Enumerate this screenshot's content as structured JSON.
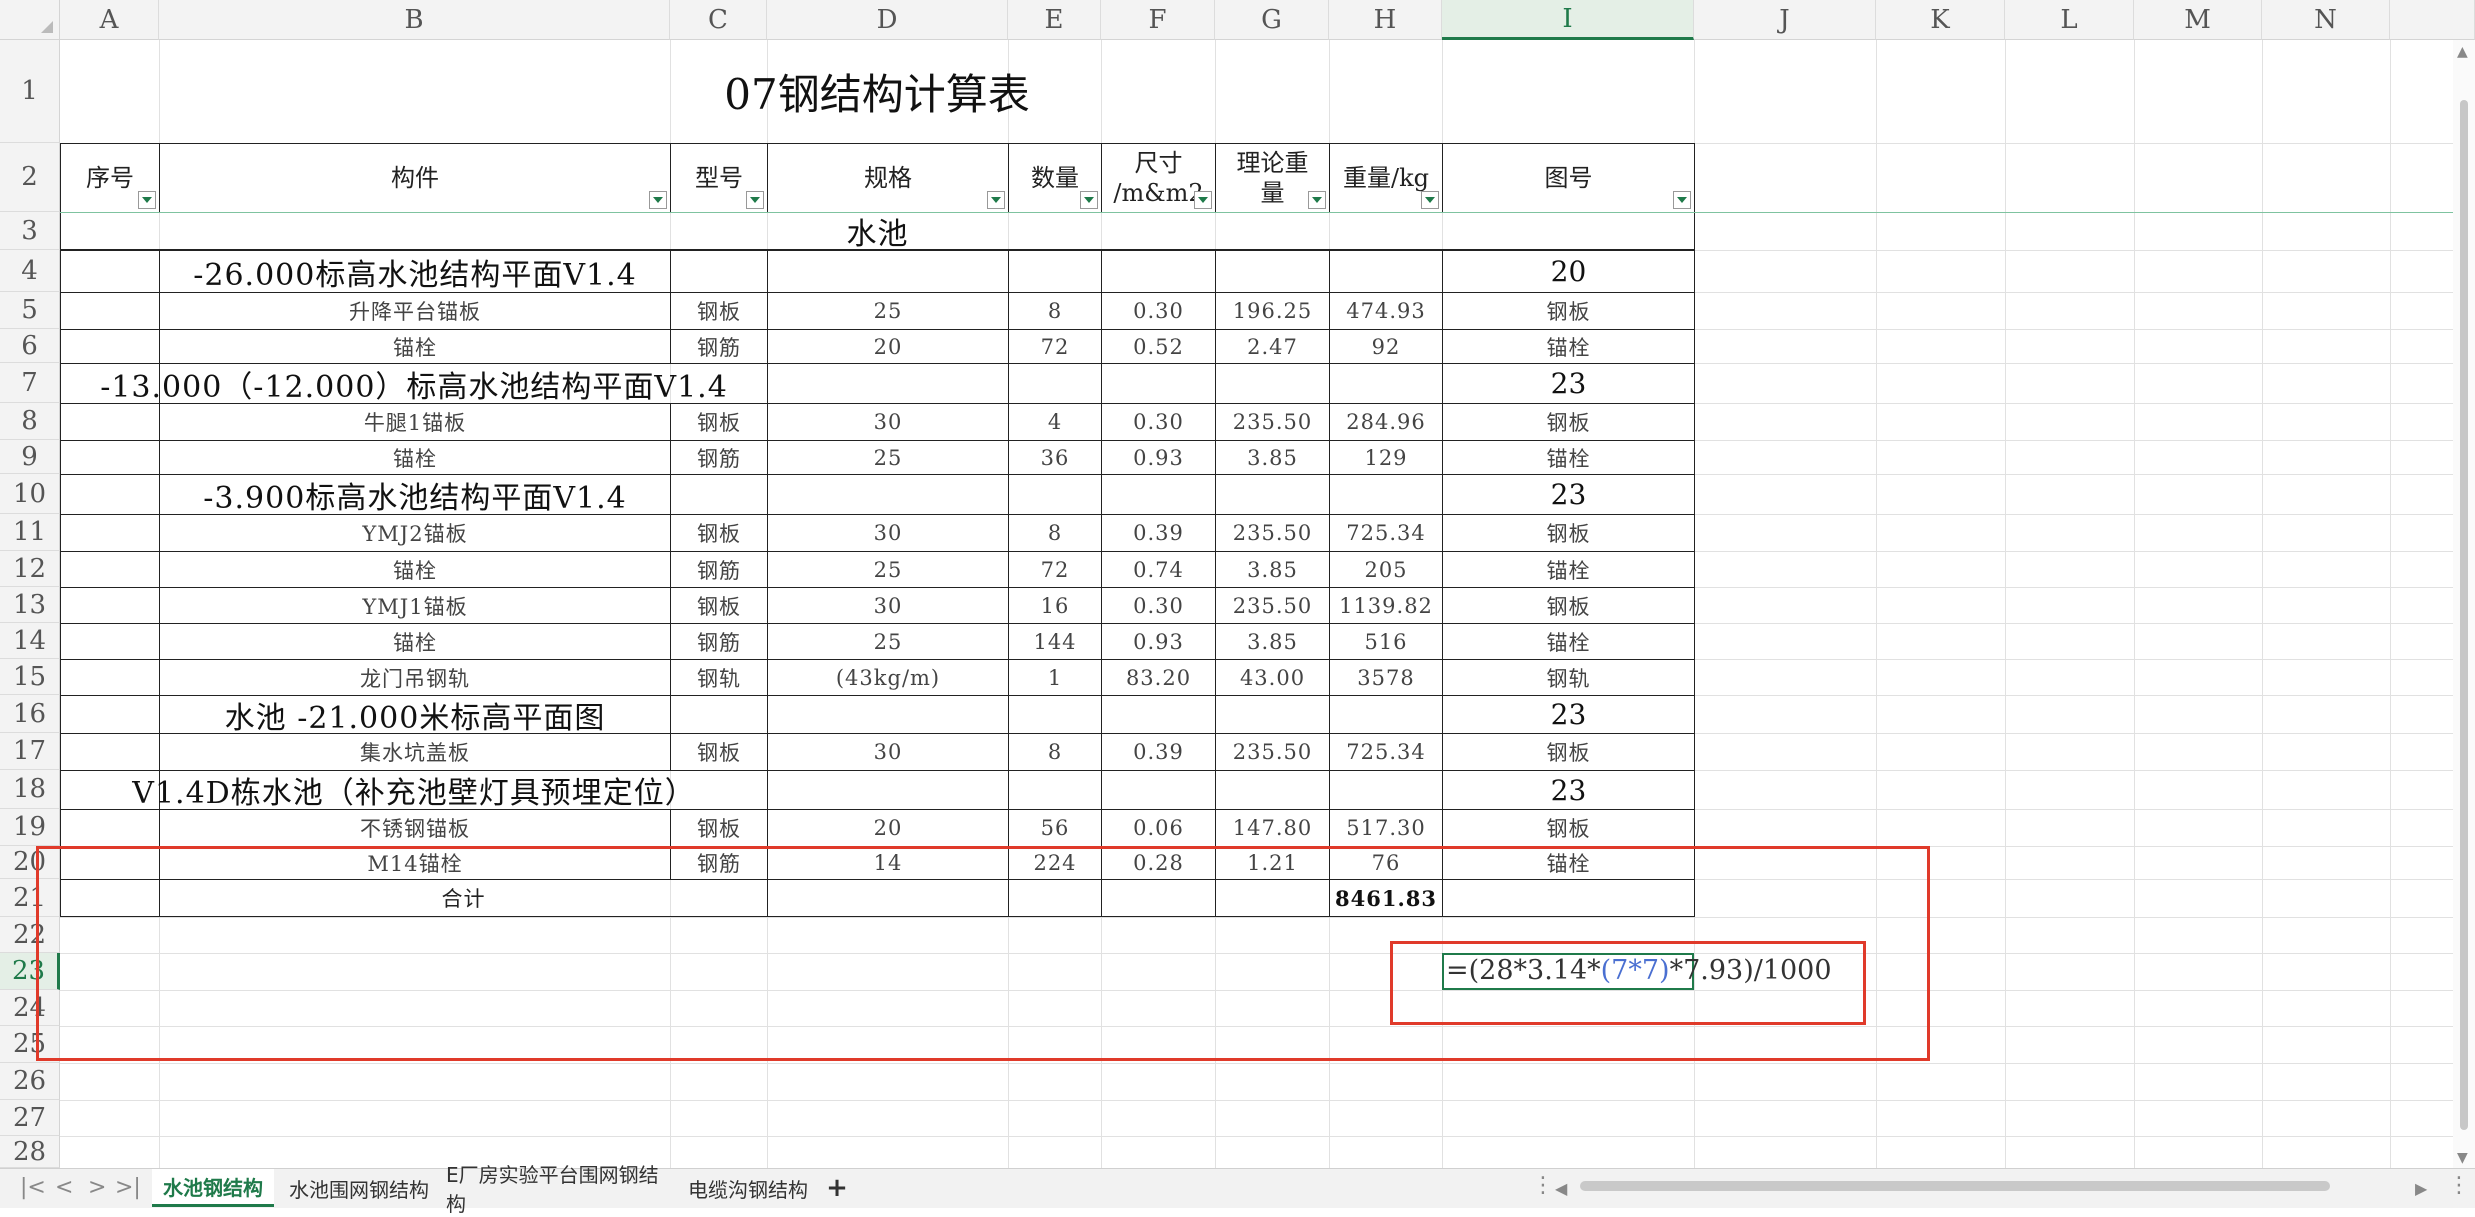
{
  "columns": [
    "A",
    "B",
    "C",
    "D",
    "E",
    "F",
    "G",
    "H",
    "I",
    "J",
    "K",
    "L",
    "M",
    "N"
  ],
  "rows": [
    "1",
    "2",
    "3",
    "4",
    "5",
    "6",
    "7",
    "8",
    "9",
    "10",
    "11",
    "12",
    "13",
    "14",
    "15",
    "16",
    "17",
    "18",
    "19",
    "20",
    "21",
    "22",
    "23",
    "24",
    "25",
    "26",
    "27",
    "28"
  ],
  "title": "07钢结构计算表",
  "headers": {
    "a": "序号",
    "b": "构件",
    "c": "型号",
    "d": "规格",
    "e": "数量",
    "f1": "尺寸",
    "f2": "/m&m2",
    "g1": "理论重",
    "g2": "量",
    "h": "重量/kg",
    "i": "图号"
  },
  "section_title": "水池",
  "sections": [
    {
      "text": "-26.000标高水池结构平面V1.4",
      "num": "20"
    },
    {
      "text": "-13.000（-12.000）标高水池结构平面V1.4",
      "num": "23"
    },
    {
      "text": "-3.900标高水池结构平面V1.4",
      "num": "23"
    },
    {
      "text": "水池  -21.000米标高平面图",
      "num": "23"
    },
    {
      "text": "V1.4D栋水池（补充池壁灯具预埋定位）",
      "num": "23"
    }
  ],
  "data_rows": [
    {
      "b": "升降平台锚板",
      "c": "钢板",
      "d": "25",
      "e": "8",
      "f": "0.30",
      "g": "196.25",
      "h": "474.93",
      "i": "钢板"
    },
    {
      "b": "锚栓",
      "c": "钢筋",
      "d": "20",
      "e": "72",
      "f": "0.52",
      "g": "2.47",
      "h": "92",
      "i": "锚栓"
    },
    {
      "b": "牛腿1锚板",
      "c": "钢板",
      "d": "30",
      "e": "4",
      "f": "0.30",
      "g": "235.50",
      "h": "284.96",
      "i": "钢板"
    },
    {
      "b": "锚栓",
      "c": "钢筋",
      "d": "25",
      "e": "36",
      "f": "0.93",
      "g": "3.85",
      "h": "129",
      "i": "锚栓"
    },
    {
      "b": "YMJ2锚板",
      "c": "钢板",
      "d": "30",
      "e": "8",
      "f": "0.39",
      "g": "235.50",
      "h": "725.34",
      "i": "钢板"
    },
    {
      "b": "锚栓",
      "c": "钢筋",
      "d": "25",
      "e": "72",
      "f": "0.74",
      "g": "3.85",
      "h": "205",
      "i": "锚栓"
    },
    {
      "b": "YMJ1锚板",
      "c": "钢板",
      "d": "30",
      "e": "16",
      "f": "0.30",
      "g": "235.50",
      "h": "1139.82",
      "i": "钢板"
    },
    {
      "b": "锚栓",
      "c": "钢筋",
      "d": "25",
      "e": "144",
      "f": "0.93",
      "g": "3.85",
      "h": "516",
      "i": "锚栓"
    },
    {
      "b": "龙门吊钢轨",
      "c": "钢轨",
      "d": "(43kg/m)",
      "e": "1",
      "f": "83.20",
      "g": "43.00",
      "h": "3578",
      "i": "钢轨"
    },
    {
      "b": "集水坑盖板",
      "c": "钢板",
      "d": "30",
      "e": "8",
      "f": "0.39",
      "g": "235.50",
      "h": "725.34",
      "i": "钢板"
    },
    {
      "b": "不锈钢锚板",
      "c": "钢板",
      "d": "20",
      "e": "56",
      "f": "0.06",
      "g": "147.80",
      "h": "517.30",
      "i": "钢板"
    },
    {
      "b": "M14锚栓",
      "c": "钢筋",
      "d": "14",
      "e": "224",
      "f": "0.28",
      "g": "1.21",
      "h": "76",
      "i": "锚栓"
    }
  ],
  "total": {
    "label": "合计",
    "value": "8461.83"
  },
  "formula": {
    "p1": "=(28*3.14*",
    "ref": "(7*7)",
    "p2": "*7.93)/1000"
  },
  "tabs": [
    "水池钢结构",
    "水池围网钢结构",
    "E厂房实验平台围网钢结构",
    "电缆沟钢结构"
  ],
  "tab_add": "+",
  "colors": {
    "accent": "#1f7a4a",
    "annotation": "#e03a2a"
  }
}
